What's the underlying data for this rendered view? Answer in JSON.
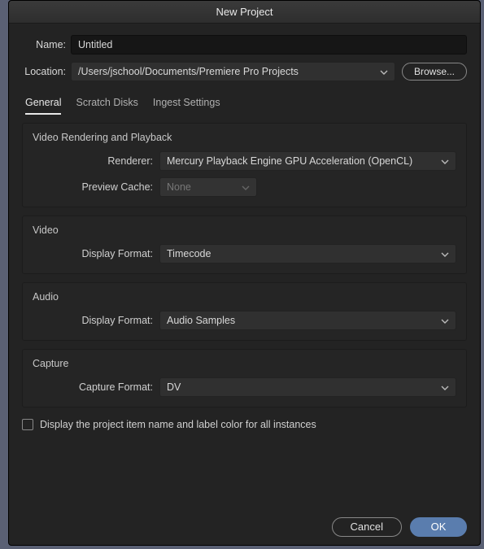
{
  "title": "New Project",
  "name": {
    "label": "Name:",
    "value": "Untitled"
  },
  "location": {
    "label": "Location:",
    "value": "/Users/jschool/Documents/Premiere Pro Projects",
    "browse": "Browse..."
  },
  "tabs": {
    "general": "General",
    "scratch": "Scratch Disks",
    "ingest": "Ingest Settings"
  },
  "sections": {
    "rendering": {
      "title": "Video Rendering and Playback",
      "renderer": {
        "label": "Renderer:",
        "value": "Mercury Playback Engine GPU Acceleration (OpenCL)"
      },
      "cache": {
        "label": "Preview Cache:",
        "value": "None"
      }
    },
    "video": {
      "title": "Video",
      "display": {
        "label": "Display Format:",
        "value": "Timecode"
      }
    },
    "audio": {
      "title": "Audio",
      "display": {
        "label": "Display Format:",
        "value": "Audio Samples"
      }
    },
    "capture": {
      "title": "Capture",
      "format": {
        "label": "Capture Format:",
        "value": "DV"
      }
    }
  },
  "checkbox": {
    "label": "Display the project item name and label color for all instances"
  },
  "buttons": {
    "cancel": "Cancel",
    "ok": "OK"
  }
}
